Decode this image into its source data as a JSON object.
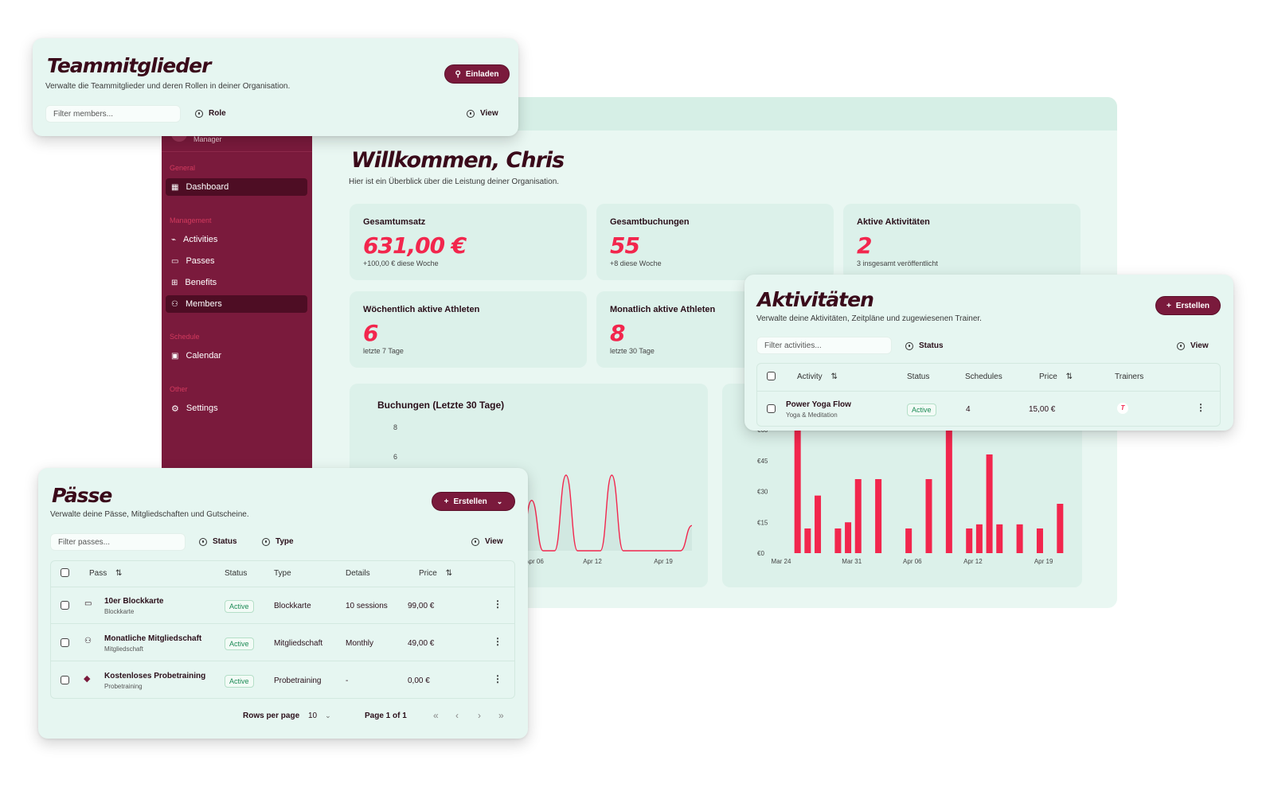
{
  "colors": {
    "accent": "#f2264d",
    "brand": "#7a1a3c",
    "sidebar": "#7a1a3c",
    "panel": "#e6f6f1"
  },
  "sidebar": {
    "user_role": "Manager",
    "groups": [
      {
        "label": "General",
        "items": [
          {
            "label": "Dashboard",
            "icon": "grid-icon",
            "active": true
          }
        ]
      },
      {
        "label": "Management",
        "items": [
          {
            "label": "Activities",
            "icon": "activity-icon"
          },
          {
            "label": "Passes",
            "icon": "ticket-icon"
          },
          {
            "label": "Benefits",
            "icon": "gift-icon"
          },
          {
            "label": "Members",
            "icon": "users-icon",
            "active": true
          }
        ]
      },
      {
        "label": "Schedule",
        "items": [
          {
            "label": "Calendar",
            "icon": "calendar-icon"
          }
        ]
      },
      {
        "label": "Other",
        "items": [
          {
            "label": "Settings",
            "icon": "gear-icon"
          }
        ]
      }
    ]
  },
  "dashboard": {
    "title": "Willkommen, Chris",
    "subtitle": "Hier ist ein Überblick über die Leistung deiner Organisation.",
    "stats": [
      {
        "label": "Gesamtumsatz",
        "value": "631,00 €",
        "note": "+100,00 € diese Woche"
      },
      {
        "label": "Gesamtbuchungen",
        "value": "55",
        "note": "+8 diese Woche"
      },
      {
        "label": "Aktive Aktivitäten",
        "value": "2",
        "note": "3 insgesamt veröffentlicht"
      },
      {
        "label": "Wöchentlich aktive Athleten",
        "value": "6",
        "note": "letzte 7 Tage"
      },
      {
        "label": "Monatlich aktive Athleten",
        "value": "8",
        "note": "letzte 30 Tage"
      }
    ]
  },
  "chart_data": [
    {
      "type": "line",
      "title": "Buchungen (Letzte 30 Tage)",
      "yticks": [
        "8",
        "6"
      ],
      "xticks": [
        "Apr 06",
        "Apr 12",
        "Apr 19"
      ],
      "x": [
        "Apr 05",
        "Apr 06",
        "Apr 07",
        "Apr 08",
        "Apr 09",
        "Apr 10",
        "Apr 11",
        "Apr 12",
        "Apr 13",
        "Apr 14",
        "Apr 15",
        "Apr 16",
        "Apr 17",
        "Apr 18",
        "Apr 19",
        "Apr 20",
        "Apr 21"
      ],
      "values": [
        0,
        0,
        2,
        0,
        0,
        3,
        0,
        0,
        0,
        3,
        0,
        0,
        0,
        0,
        0,
        0,
        1
      ]
    },
    {
      "type": "bar",
      "yticks": [
        "€60",
        "€45",
        "€30",
        "€15",
        "€0"
      ],
      "xticks": [
        "Mar 24",
        "Mar 31",
        "Apr 06",
        "Apr 12",
        "Apr 19"
      ],
      "ylim": [
        0,
        60
      ],
      "categories": [
        "Mar 24",
        "Mar 25",
        "Mar 26",
        "Mar 27",
        "Mar 28",
        "Mar 29",
        "Mar 30",
        "Mar 31",
        "Apr 01",
        "Apr 02",
        "Apr 03",
        "Apr 04",
        "Apr 05",
        "Apr 06",
        "Apr 07",
        "Apr 08",
        "Apr 09",
        "Apr 10",
        "Apr 11",
        "Apr 12",
        "Apr 13",
        "Apr 14",
        "Apr 15",
        "Apr 16",
        "Apr 17",
        "Apr 18",
        "Apr 19",
        "Apr 20",
        "Apr 21"
      ],
      "values": [
        0,
        0,
        0,
        0,
        0,
        0,
        0,
        0,
        0,
        0,
        0,
        0,
        0,
        0,
        0,
        0,
        0,
        0,
        0,
        0,
        0,
        0,
        0,
        0,
        0,
        0,
        0,
        0,
        0
      ],
      "bars": [
        {
          "x": "Mar 25",
          "value": 60
        },
        {
          "x": "Mar 26",
          "value": 12
        },
        {
          "x": "Mar 27",
          "value": 28
        },
        {
          "x": "Mar 29",
          "value": 12
        },
        {
          "x": "Mar 30",
          "value": 15
        },
        {
          "x": "Mar 31",
          "value": 36
        },
        {
          "x": "Apr 02",
          "value": 36
        },
        {
          "x": "Apr 05",
          "value": 12
        },
        {
          "x": "Apr 07",
          "value": 36
        },
        {
          "x": "Apr 09",
          "value": 60
        },
        {
          "x": "Apr 11",
          "value": 12
        },
        {
          "x": "Apr 12",
          "value": 14
        },
        {
          "x": "Apr 13",
          "value": 48
        },
        {
          "x": "Apr 14",
          "value": 14
        },
        {
          "x": "Apr 16",
          "value": 14
        },
        {
          "x": "Apr 18",
          "value": 12
        },
        {
          "x": "Apr 20",
          "value": 24
        }
      ]
    }
  ],
  "team": {
    "title": "Teammitglieder",
    "subtitle": "Verwalte die Teammitglieder und deren Rollen in deiner Organisation.",
    "invite_label": "Einladen",
    "filter_placeholder": "Filter members...",
    "role_label": "Role",
    "view_label": "View"
  },
  "activities": {
    "title": "Aktivitäten",
    "subtitle": "Verwalte deine Aktivitäten, Zeitpläne und zugewiesenen Trainer.",
    "create_label": "Erstellen",
    "filter_placeholder": "Filter activities...",
    "status_label": "Status",
    "view_label": "View",
    "columns": [
      "Activity",
      "Status",
      "Schedules",
      "Price",
      "Trainers"
    ],
    "rows": [
      {
        "name": "Power Yoga Flow",
        "category": "Yoga & Meditation",
        "status": "Active",
        "schedules": "4",
        "price": "15,00 €",
        "trainer": "T"
      }
    ]
  },
  "passes": {
    "title": "Pässe",
    "subtitle": "Verwalte deine Pässe, Mitgliedschaften und Gutscheine.",
    "create_label": "Erstellen",
    "filter_placeholder": "Filter passes...",
    "status_label": "Status",
    "type_label": "Type",
    "view_label": "View",
    "columns": [
      "Pass",
      "Status",
      "Type",
      "Details",
      "Price"
    ],
    "rows": [
      {
        "name": "10er Blockkarte",
        "sub": "Blockkarte",
        "icon": "card-icon",
        "status": "Active",
        "type": "Blockkarte",
        "details": "10 sessions",
        "price": "99,00 €"
      },
      {
        "name": "Monatliche Mitgliedschaft",
        "sub": "Mitgliedschaft",
        "icon": "users-icon",
        "status": "Active",
        "type": "Mitgliedschaft",
        "details": "Monthly",
        "price": "49,00 €"
      },
      {
        "name": "Kostenloses Probetraining",
        "sub": "Probetraining",
        "icon": "dumbbell-icon",
        "status": "Active",
        "type": "Probetraining",
        "details": "-",
        "price": "0,00 €"
      }
    ],
    "rows_per_page_label": "Rows per page",
    "rows_per_page": "10",
    "page_label": "Page 1 of 1"
  }
}
